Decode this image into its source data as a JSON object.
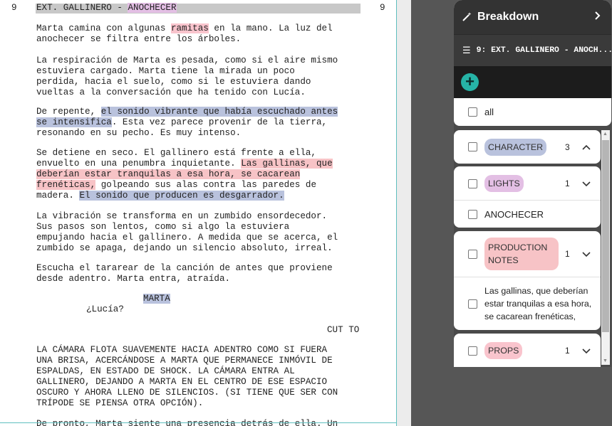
{
  "script": {
    "scene_number": "9",
    "heading_prefix": "EXT. GALLINERO - ",
    "heading_light": "ANOCHECER",
    "p1": {
      "a": "Marta camina con algunas ",
      "prop": "ramitas",
      "b": " en la mano. La luz del",
      "c": "anochecer se filtra entre los árboles."
    },
    "p2": [
      "La respiración de Marta es pesada, como si el aire mismo",
      "estuviera cargado. Marta tiene la mirada un poco",
      "perdida, hacia el suelo, como si le estuviera dando",
      "vueltas a la conversación que ha tenido con Lucía."
    ],
    "p3": {
      "a": "De repente, ",
      "hl1": "el sonido vibrante que había escuchado antes",
      "hl2": "se intensifica",
      "b": ". Esta vez parece provenir de la tierra,",
      "c": "resonando en su pecho. Es muy intenso."
    },
    "p4": {
      "l1": "Se detiene en seco. El gallinero está frente a ella,",
      "l2a": "envuelto en una penumbra inquietante. ",
      "l2hl": "Las gallinas, que",
      "l3hl": "deberían estar tranquilas a esa hora, se cacarean",
      "l4hl": "frenéticas,",
      "l4b": " golpeando sus alas contra las paredes de",
      "l5a": "madera. ",
      "l5hl": "El sonido que producen es desgarrador."
    },
    "p5": [
      "La vibración se transforma en un zumbido ensordecedor.",
      "Sus pasos son lentos, como si algo la estuviera",
      "empujando hacia el gallinero. A medida que se acerca, el",
      "zumbido se apaga, dejando un silencio absoluto, irreal."
    ],
    "p6": [
      "Escucha el tararear de la canción de antes que proviene",
      "desde adentro. Marta entra, atraída."
    ],
    "character": "MARTA",
    "dialogue": "¿Lucía?",
    "transition": "CUT TO",
    "p7": [
      "LA CÁMARA FLOTA SUAVEMENTE HACIA ADENTRO COMO SI FUERA",
      "UNA BRISA, ACERCÁNDOSE A MARTA QUE PERMANECE INMÓVIL DE",
      "ESPALDAS, EN ESTADO DE SHOCK. LA CÁMARA ENTRA AL",
      "GALLINERO, DEJANDO A MARTA EN EL CENTRO DE ESE ESPACIO",
      "OSCURO Y AHORA LLENO DE SILENCIOS. (SI TIENE QUE SER CON",
      "TRÍPODE SE PIENSA OTRA OPCIÓN)."
    ],
    "p8": "De pronto, Marta siente una presencia detrás de ella. Un"
  },
  "breakdown": {
    "title": "Breakdown",
    "scene_label": "9: EXT. GALLINERO - ANOCH...",
    "add_label": "+",
    "all_label": "all",
    "categories": [
      {
        "label": "CHARACTER",
        "count": "3",
        "color": "#b9c2dd",
        "expanded": true
      },
      {
        "label": "LIGHTS",
        "count": "1",
        "color": "#e3bfe4",
        "expanded": false
      },
      {
        "label": "PRODUCTION NOTES",
        "count": "1",
        "color": "#f7c3c6",
        "expanded": false
      },
      {
        "label": "PROPS",
        "count": "1",
        "color": "#f9c4cd",
        "expanded": false
      }
    ],
    "lights_item": "ANOCHECER",
    "prodnote_item": [
      "Las gallinas, que deberían",
      "estar tranquilas a esa hora,",
      "se cacarean frenéticas,"
    ]
  }
}
